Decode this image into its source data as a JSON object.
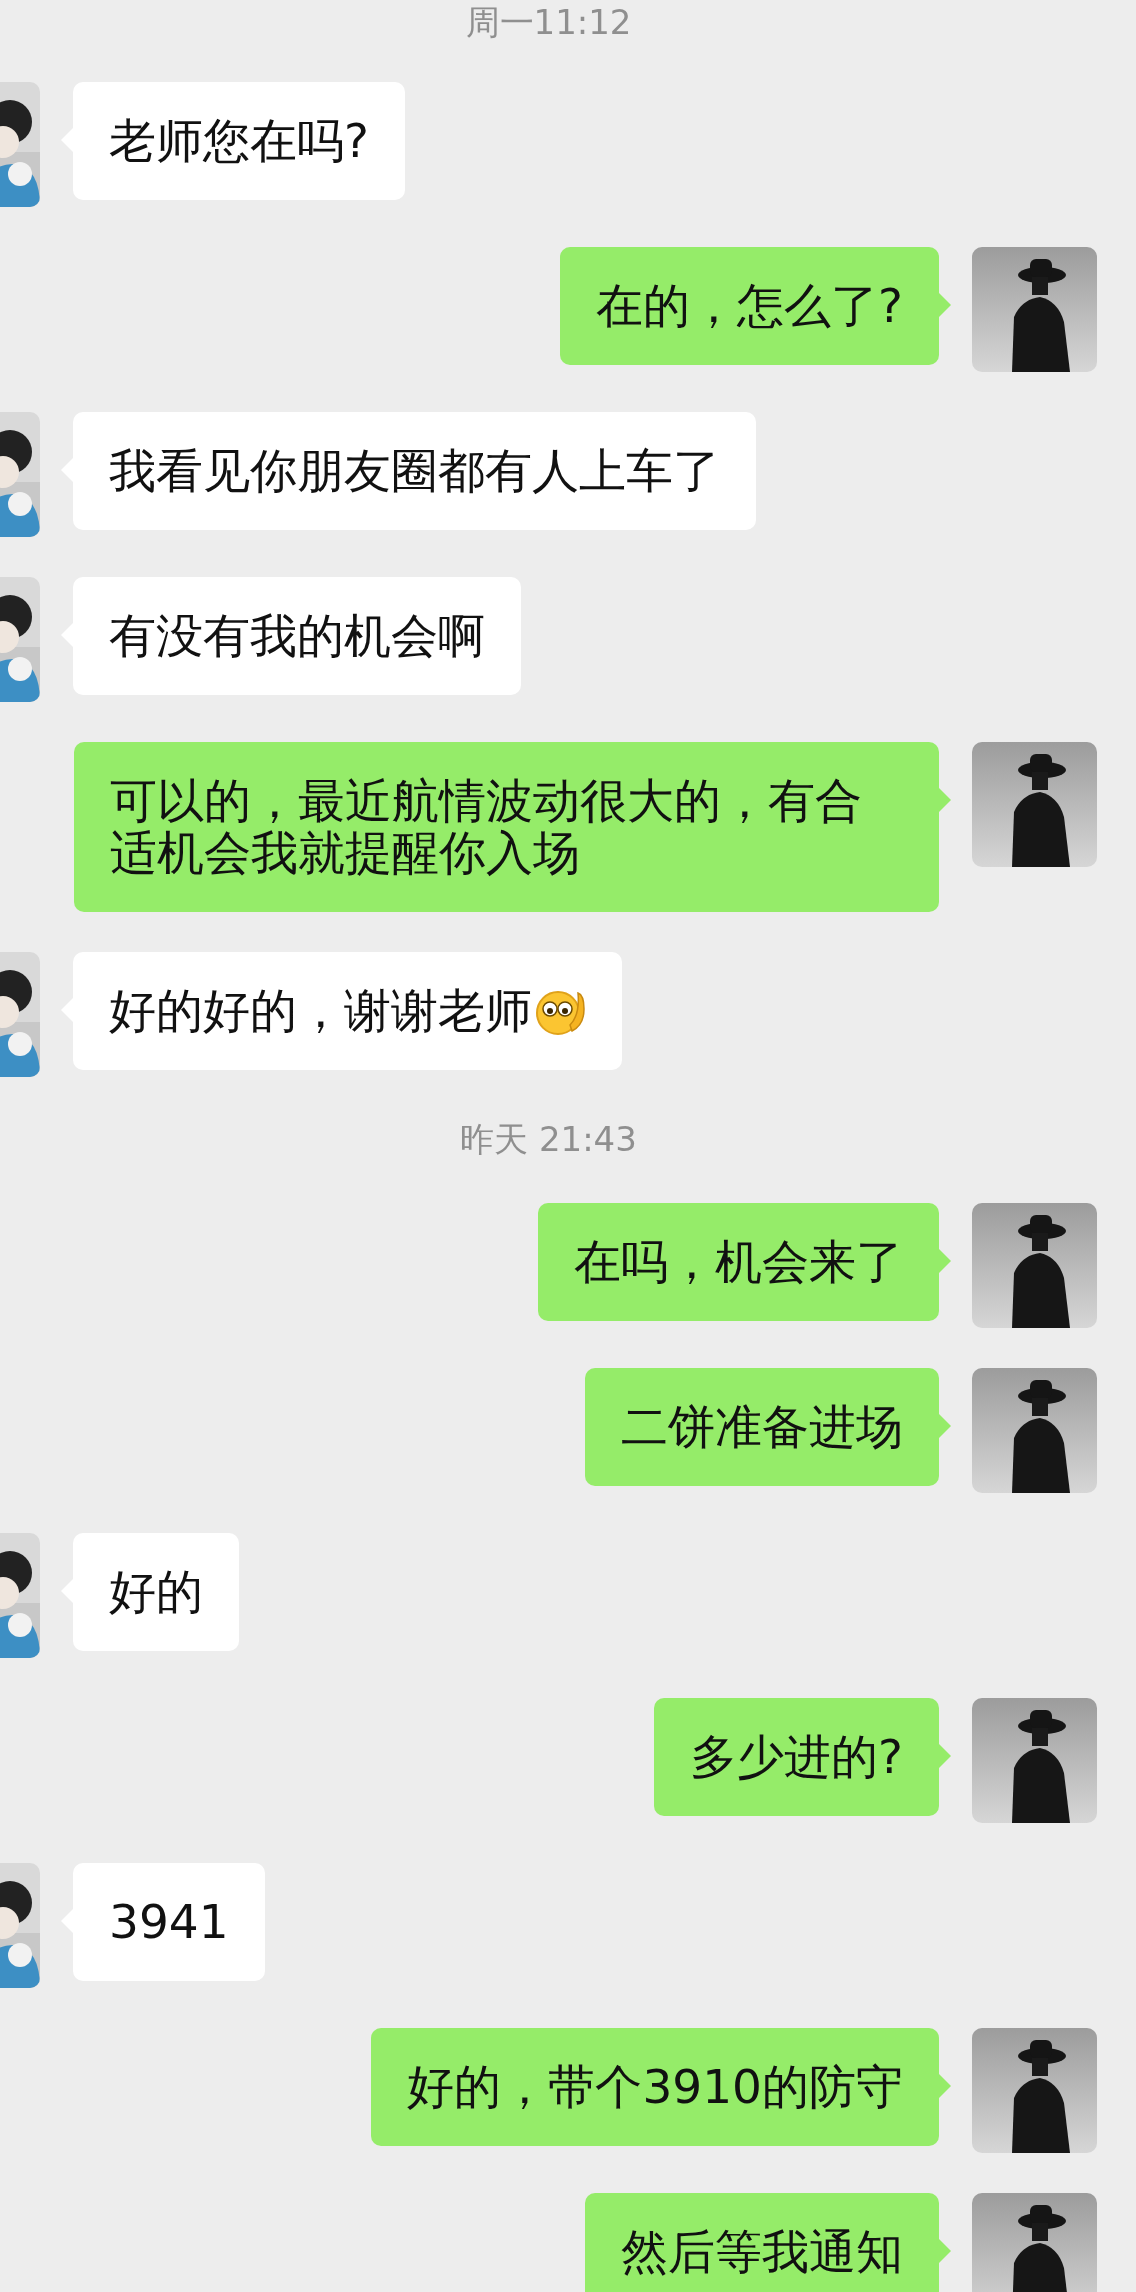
{
  "chat": [
    {
      "kind": "time",
      "text": "周一11:12"
    },
    {
      "kind": "received",
      "text": "老师您在吗?"
    },
    {
      "kind": "sent",
      "text": "在的，怎么了?"
    },
    {
      "kind": "received",
      "text": "我看见你朋友圈都有人上车了"
    },
    {
      "kind": "received",
      "text": "有没有我的机会啊"
    },
    {
      "kind": "sent",
      "text": "可以的，最近航情波动很大的，有合适机会我就提醒你入场"
    },
    {
      "kind": "received",
      "text": "好的好的，谢谢老师",
      "emoji": true
    },
    {
      "kind": "time",
      "text": "昨天 21:43"
    },
    {
      "kind": "sent",
      "text": "在吗，机会来了"
    },
    {
      "kind": "sent",
      "text": "二饼准备进场"
    },
    {
      "kind": "received",
      "text": "好的"
    },
    {
      "kind": "sent",
      "text": "多少进的?"
    },
    {
      "kind": "received",
      "text": "3941"
    },
    {
      "kind": "sent",
      "text": "好的，带个3910的防守"
    },
    {
      "kind": "sent",
      "text": "然后等我通知"
    }
  ]
}
